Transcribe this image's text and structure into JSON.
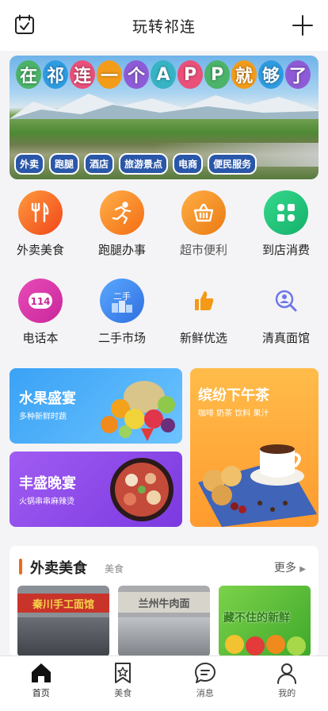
{
  "header": {
    "title": "玩转祁连"
  },
  "banner": {
    "headline": [
      "在",
      "祁",
      "连",
      "一",
      "个",
      "A",
      "P",
      "P",
      "就",
      "够",
      "了"
    ],
    "tags": [
      "外卖",
      "跑腿",
      "酒店",
      "旅游景点",
      "电商",
      "便民服务"
    ]
  },
  "categories": [
    {
      "label": "外卖美食",
      "icon": "fork-knife-icon",
      "color": "#f26a1b"
    },
    {
      "label": "跑腿办事",
      "icon": "runner-icon",
      "color": "#f78c1a"
    },
    {
      "label": "超市便利",
      "icon": "basket-icon",
      "color": "#f28b1e"
    },
    {
      "label": "到店消费",
      "icon": "grid-leaf-icon",
      "color": "#25c47a"
    },
    {
      "label": "电话本",
      "icon": "phonebook-114-icon",
      "color": "#d23aa5"
    },
    {
      "label": "二手市场",
      "icon": "secondhand-icon",
      "color": "#3f8ff0"
    },
    {
      "label": "新鲜优选",
      "icon": "thumbs-up-icon",
      "color": "#f49a16"
    },
    {
      "label": "清真面馆",
      "icon": "search-person-icon",
      "color": "#6d77e8"
    }
  ],
  "promos": {
    "fruit": {
      "title": "水果盛宴",
      "subtitle": "多种新鲜时蔬"
    },
    "dinner": {
      "title": "丰盛晚宴",
      "subtitle": "火锅串串麻辣烫"
    },
    "tea": {
      "title": "缤纷下午茶",
      "subtitle": "咖啡 奶茶 饮料 果汁"
    }
  },
  "section": {
    "title": "外卖美食",
    "subtitle": "美食",
    "more": "更多",
    "thumbs": [
      {
        "text": "秦川手工面馆"
      },
      {
        "text": "兰州牛肉面"
      },
      {
        "text": "藏不住的新鲜"
      }
    ]
  },
  "tabs": [
    {
      "label": "首页",
      "icon": "home-icon"
    },
    {
      "label": "美食",
      "icon": "bookmark-star-icon"
    },
    {
      "label": "消息",
      "icon": "chat-bubble-icon"
    },
    {
      "label": "我的",
      "icon": "person-icon"
    }
  ]
}
